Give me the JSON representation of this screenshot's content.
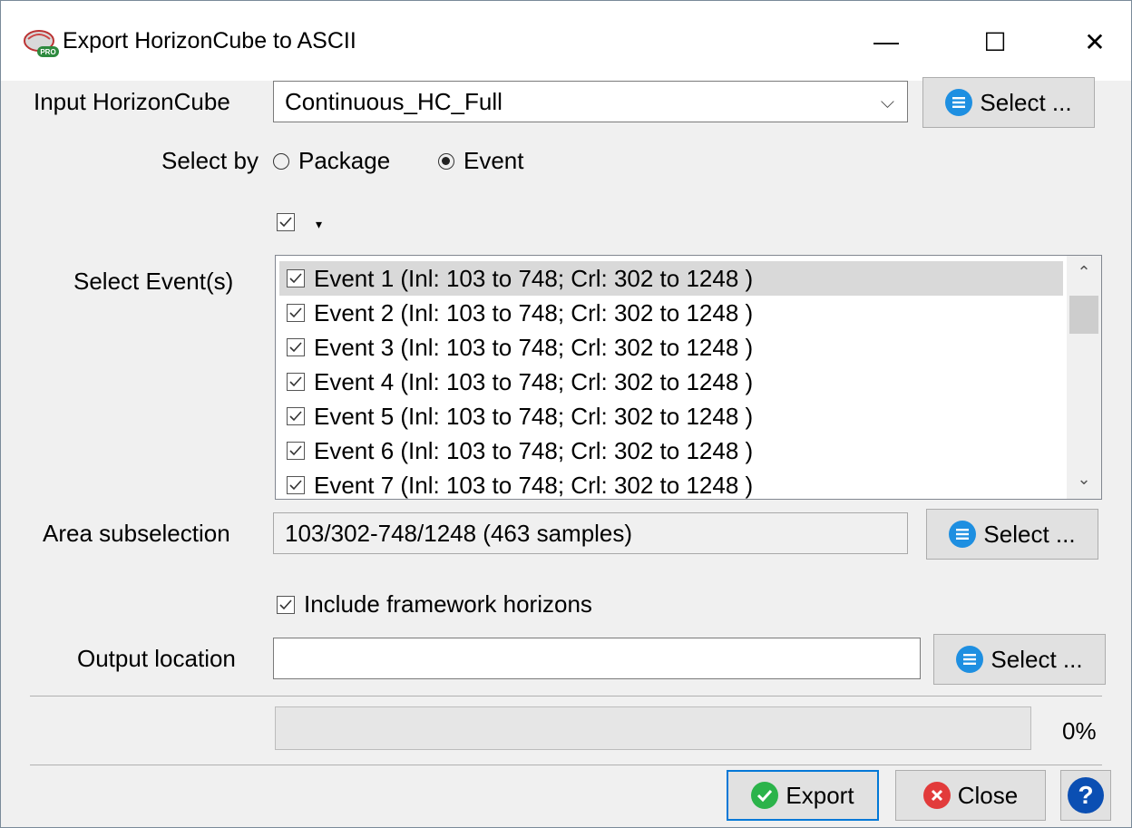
{
  "window": {
    "title": "Export HorizonCube to ASCII",
    "controls": {
      "minimize": "—",
      "maximize": "☐",
      "close": "✕"
    }
  },
  "input_horizoncube": {
    "label": "Input HorizonCube",
    "value": "Continuous_HC_Full",
    "select_label": "Select ..."
  },
  "select_by": {
    "label": "Select by",
    "options": [
      {
        "label": "Package",
        "selected": false
      },
      {
        "label": "Event",
        "selected": true
      }
    ]
  },
  "select_all": {
    "checked": true
  },
  "events": {
    "label": "Select Event(s)",
    "items": [
      {
        "label": "Event 1  (Inl: 103 to 748; Crl: 302 to 1248 )",
        "checked": true,
        "selected": true
      },
      {
        "label": "Event 2  (Inl: 103 to 748; Crl: 302 to 1248 )",
        "checked": true
      },
      {
        "label": "Event 3  (Inl: 103 to 748; Crl: 302 to 1248 )",
        "checked": true
      },
      {
        "label": "Event 4  (Inl: 103 to 748; Crl: 302 to 1248 )",
        "checked": true
      },
      {
        "label": "Event 5  (Inl: 103 to 748; Crl: 302 to 1248 )",
        "checked": true
      },
      {
        "label": "Event 6  (Inl: 103 to 748; Crl: 302 to 1248 )",
        "checked": true
      },
      {
        "label": "Event 7  (Inl: 103 to 748; Crl: 302 to 1248 )",
        "checked": true
      }
    ]
  },
  "area_subselection": {
    "label": "Area subselection",
    "value": "103/302-748/1248 (463 samples)",
    "select_label": "Select ..."
  },
  "include_framework": {
    "label": "Include framework horizons",
    "checked": true
  },
  "output_location": {
    "label": "Output location",
    "value": "",
    "select_label": "Select ..."
  },
  "progress": {
    "value": 0,
    "label": "0%"
  },
  "buttons": {
    "export": "Export",
    "close": "Close",
    "help": "?"
  },
  "colors": {
    "accent": "#0078d7",
    "select_icon": "#1e8fe1",
    "export_icon": "#2bb34a",
    "close_icon": "#e23b3b",
    "help_icon": "#0b4fb3"
  }
}
